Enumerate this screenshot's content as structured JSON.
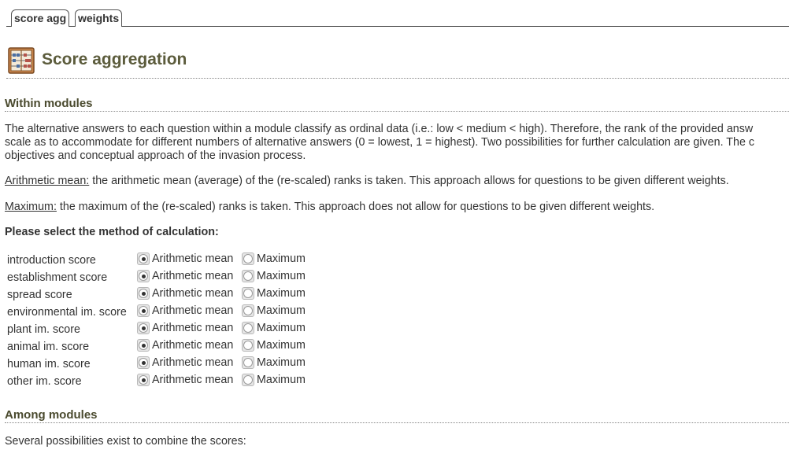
{
  "tabs": [
    {
      "label": "score agg"
    },
    {
      "label": "weights"
    }
  ],
  "header": {
    "title": "Score aggregation",
    "icon": "abacus-icon"
  },
  "within": {
    "heading": "Within modules",
    "para1_line1": "The alternative answers to each question within a module classify as ordinal data (i.e.: low < medium < high). Therefore, the rank of the provided answ",
    "para1_line2": "scale as to accommodate for different numbers of alternative answers (0 = lowest, 1 = highest). Two possibilities for further calculation are given. The c",
    "para1_line3": "objectives and conceptual approach of the invasion process.",
    "mean_term": "Arithmetic mean:",
    "mean_desc": " the arithmetic mean (average) of the (re-scaled) ranks is taken. This approach allows for questions to be given different weights.",
    "max_term": "Maximum:",
    "max_desc": " the maximum of the (re-scaled) ranks is taken. This approach does not allow for questions to be given different weights.",
    "select_label": "Please select the method of calculation:"
  },
  "options": {
    "mean_label": "Arithmetic mean",
    "max_label": "Maximum"
  },
  "scores": [
    {
      "label": "introduction score",
      "selected": "mean"
    },
    {
      "label": "establishment score",
      "selected": "mean"
    },
    {
      "label": "spread score",
      "selected": "mean"
    },
    {
      "label": "environmental im. score",
      "selected": "mean"
    },
    {
      "label": "plant im. score",
      "selected": "mean"
    },
    {
      "label": "animal im. score",
      "selected": "mean"
    },
    {
      "label": "human im. score",
      "selected": "mean"
    },
    {
      "label": "other im. score",
      "selected": "mean"
    }
  ],
  "among": {
    "heading": "Among modules",
    "intro": "Several possibilities exist to combine the scores:"
  },
  "colors": {
    "title": "#5c5c3c",
    "heading": "#4a4a2e",
    "text": "#333333"
  }
}
